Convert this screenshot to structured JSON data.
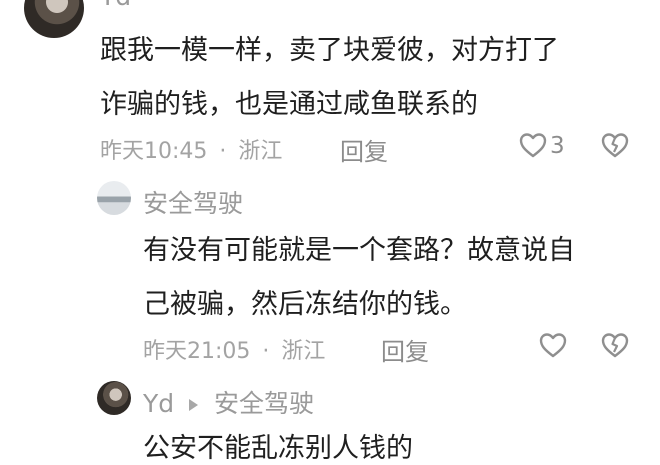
{
  "comments": [
    {
      "username": "Yd",
      "text_lines": [
        "跟我一模一样，卖了块爱彼，对方打了",
        "诈骗的钱，也是通过咸鱼联系的"
      ],
      "time": "昨天10:45",
      "location": "浙江",
      "reply_label": "回复",
      "like_count": "3"
    },
    {
      "username": "安全驾驶",
      "text_lines": [
        "有没有可能就是一个套路？故意说自",
        "己被骗，然后冻结你的钱。"
      ],
      "time": "昨天21:05",
      "location": "浙江",
      "reply_label": "回复"
    },
    {
      "username": "Yd",
      "reply_to": "安全驾驶",
      "text_lines": [
        "公安不能乱冻别人钱的"
      ]
    }
  ],
  "icons": {
    "like": "heart-outline-icon",
    "dislike": "broken-heart-icon",
    "reply_arrow": "triangle-right-icon"
  }
}
